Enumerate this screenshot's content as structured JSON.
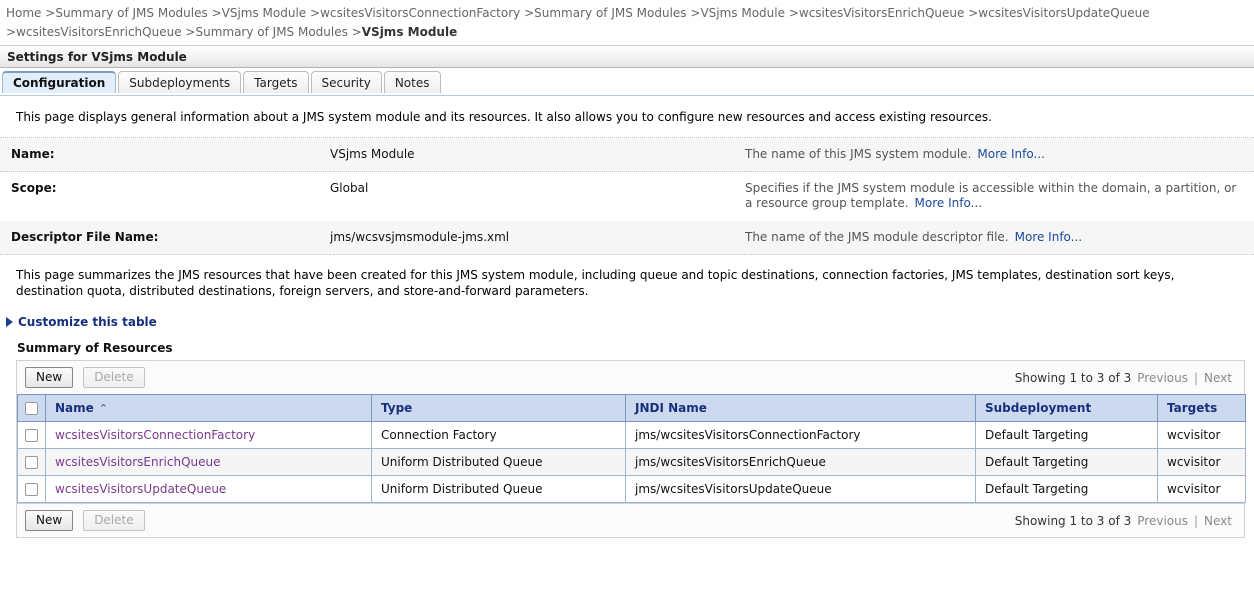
{
  "breadcrumb": {
    "items": [
      {
        "label": "Home",
        "current": false
      },
      {
        "label": "Summary of JMS Modules",
        "current": false
      },
      {
        "label": "VSjms Module",
        "current": false
      },
      {
        "label": "wcsitesVisitorsConnectionFactory",
        "current": false
      },
      {
        "label": "Summary of JMS Modules",
        "current": false
      },
      {
        "label": "VSjms Module",
        "current": false
      },
      {
        "label": "wcsitesVisitorsEnrichQueue",
        "current": false
      },
      {
        "label": "wcsitesVisitorsUpdateQueue",
        "current": false
      },
      {
        "label": "wcsitesVisitorsEnrichQueue",
        "current": false
      },
      {
        "label": "Summary of JMS Modules",
        "current": false
      },
      {
        "label": "VSjms Module",
        "current": true
      }
    ],
    "separator": ">"
  },
  "page": {
    "title": "Settings for VSjms Module"
  },
  "tabs": [
    {
      "label": "Configuration",
      "active": true
    },
    {
      "label": "Subdeployments",
      "active": false
    },
    {
      "label": "Targets",
      "active": false
    },
    {
      "label": "Security",
      "active": false
    },
    {
      "label": "Notes",
      "active": false
    }
  ],
  "intro_paragraph": "This page displays general information about a JMS system module and its resources. It also allows you to configure new resources and access existing resources.",
  "properties": [
    {
      "label": "Name:",
      "value": "VSjms Module",
      "description": "The name of this JMS system module.",
      "more_info": "More Info..."
    },
    {
      "label": "Scope:",
      "value": "Global",
      "description": "Specifies if the JMS system module is accessible within the domain, a partition, or a resource group template.",
      "more_info": "More Info..."
    },
    {
      "label": "Descriptor File Name:",
      "value": "jms/wcsvsjmsmodule-jms.xml",
      "description": "The name of the JMS module descriptor file.",
      "more_info": "More Info..."
    }
  ],
  "summary_paragraph": "This page summarizes the JMS resources that have been created for this JMS system module, including queue and topic destinations, connection factories, JMS templates, destination sort keys, destination quota, distributed destinations, foreign servers, and store-and-forward parameters.",
  "customize_link": "Customize this table",
  "section_title": "Summary of Resources",
  "toolbar": {
    "new_label": "New",
    "delete_label": "Delete",
    "delete_disabled": true
  },
  "paging": {
    "showing": "Showing 1 to 3 of 3",
    "previous": "Previous",
    "separator": "|",
    "next": "Next"
  },
  "table": {
    "columns": [
      {
        "label": "Name",
        "sorted": "asc"
      },
      {
        "label": "Type",
        "sorted": null
      },
      {
        "label": "JNDI Name",
        "sorted": null
      },
      {
        "label": "Subdeployment",
        "sorted": null
      },
      {
        "label": "Targets",
        "sorted": null
      }
    ],
    "sort_glyph": "⌃",
    "rows": [
      {
        "name": "wcsitesVisitorsConnectionFactory",
        "type": "Connection Factory",
        "jndi": "jms/wcsitesVisitorsConnectionFactory",
        "subdeployment": "Default Targeting",
        "targets": "wcvisitor"
      },
      {
        "name": "wcsitesVisitorsEnrichQueue",
        "type": "Uniform Distributed Queue",
        "jndi": "jms/wcsitesVisitorsEnrichQueue",
        "subdeployment": "Default Targeting",
        "targets": "wcvisitor"
      },
      {
        "name": "wcsitesVisitorsUpdateQueue",
        "type": "Uniform Distributed Queue",
        "jndi": "jms/wcsitesVisitorsUpdateQueue",
        "subdeployment": "Default Targeting",
        "targets": "wcvisitor"
      }
    ]
  },
  "colors": {
    "tab_active_bg": "#e3eefb",
    "table_header_bg": "#ccd9ee",
    "table_header_text": "#16307d",
    "row_link": "#7a3a8c",
    "more_info_link": "#1b4b9c",
    "customize_link": "#16307d"
  }
}
